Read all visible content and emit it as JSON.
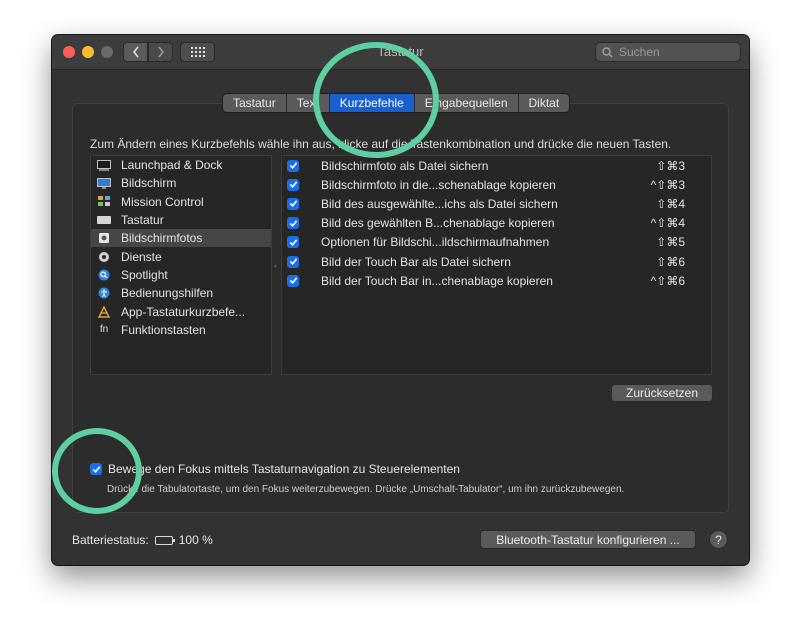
{
  "window": {
    "title": "Tastatur",
    "search_placeholder": "Suchen",
    "accent_color": "#1a5fd0",
    "highlight_color": "#5dcfa0"
  },
  "tabs": [
    {
      "label": "Tastatur",
      "active": false
    },
    {
      "label": "Text",
      "active": false
    },
    {
      "label": "Kurzbefehle",
      "active": true
    },
    {
      "label": "Eingabequellen",
      "active": false
    },
    {
      "label": "Diktat",
      "active": false
    }
  ],
  "instruction": "Zum Ändern eines Kurzbefehls wähle ihn aus, klicke auf die Tastenkombination und drücke die neuen Tasten.",
  "categories": [
    {
      "label": "Launchpad & Dock",
      "icon": "launchpad-icon",
      "selected": false
    },
    {
      "label": "Bildschirm",
      "icon": "display-icon",
      "selected": false
    },
    {
      "label": "Mission Control",
      "icon": "mission-control-icon",
      "selected": false
    },
    {
      "label": "Tastatur",
      "icon": "keyboard-icon",
      "selected": false
    },
    {
      "label": "Bildschirmfotos",
      "icon": "screenshot-icon",
      "selected": true
    },
    {
      "label": "Dienste",
      "icon": "gear-icon",
      "selected": false
    },
    {
      "label": "Spotlight",
      "icon": "spotlight-icon",
      "selected": false
    },
    {
      "label": "Bedienungshilfen",
      "icon": "accessibility-icon",
      "selected": false
    },
    {
      "label": "App-Tastaturkurzbefe...",
      "icon": "app-shortcuts-icon",
      "selected": false
    },
    {
      "label": "Funktionstasten",
      "icon": "fn-icon",
      "selected": false
    }
  ],
  "shortcuts": [
    {
      "label": "Bildschirmfoto als Datei sichern",
      "keys": "⇧⌘3",
      "checked": true
    },
    {
      "label": "Bildschirmfoto in die...schenablage kopieren",
      "keys": "^⇧⌘3",
      "checked": true
    },
    {
      "label": "Bild des ausgewählte...ichs als Datei sichern",
      "keys": "⇧⌘4",
      "checked": true
    },
    {
      "label": "Bild des gewählten B...chenablage kopieren",
      "keys": "^⇧⌘4",
      "checked": true
    },
    {
      "label": "Optionen für Bildschi...ildschirmaufnahmen",
      "keys": "⇧⌘5",
      "checked": true
    },
    {
      "label": "Bild der Touch Bar als Datei sichern",
      "keys": "⇧⌘6",
      "checked": true
    },
    {
      "label": "Bild der Touch Bar in...chenablage kopieren",
      "keys": "^⇧⌘6",
      "checked": true
    }
  ],
  "reset_label": "Zurücksetzen",
  "focus": {
    "label": "Bewege den Fokus mittels Tastaturnavigation zu Steuerelementen",
    "hint": "Drücke die Tabulatortaste, um den Fokus weiterzubewegen. Drücke „Umschalt-Tabulator“, um ihn zurückzubewegen.",
    "checked": true
  },
  "battery": {
    "label": "Batteriestatus:",
    "value": "100 %"
  },
  "bluetooth_label": "Bluetooth-Tastatur konfigurieren ...",
  "help_label": "?"
}
